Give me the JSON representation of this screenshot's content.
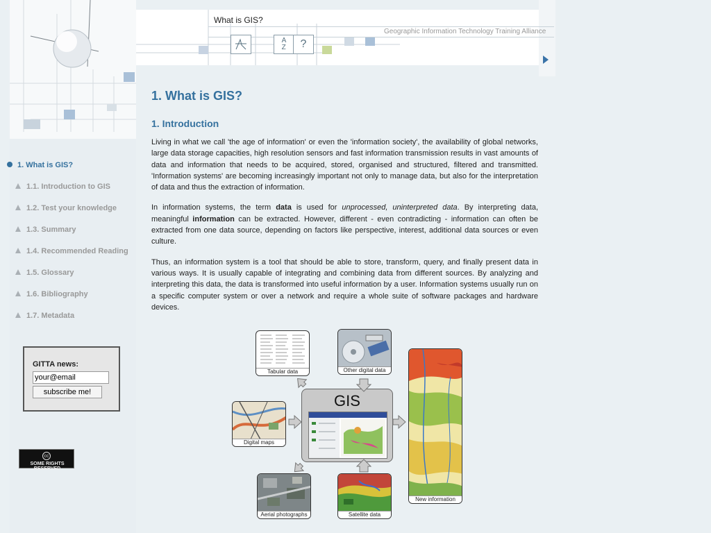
{
  "header": {
    "page_title": "What is GIS?",
    "org_name": "Geographic Information Technology Training Alliance",
    "tool_icons": [
      "glossary-icon",
      "a-z-icon",
      "help-icon"
    ],
    "accent_color": "#35719e"
  },
  "main": {
    "title": "1. What is GIS?",
    "section_title": "1. Introduction",
    "paragraphs": [
      [
        "Living in what we call 'the age of information' or even the 'information society', the availability of global networks, large data storage capacities, high resolution sensors and fast information transmission results in vast amounts of data and information that needs to be acquired, stored, organised and structured, filtered and transmitted. 'Information systems' are becoming increasingly important not only to manage data, but also for the interpretation of data and thus the extraction of information."
      ],
      {
        "p2_a": "In information systems, the term ",
        "p2_b": "data",
        "p2_c": " is used for ",
        "p2_d": "unprocessed, uninterpreted data",
        "p2_e": ". By interpreting data, meaningful ",
        "p2_f": "information",
        "p2_g": " can be extracted. However, different - even contradicting - information can often be extracted from one data source, depending on factors like perspective, interest, additional data sources or even culture."
      },
      [
        "Thus, an information system is a tool that should be able to store, transform, query, and finally present data in various ways. It is usually capable of integrating and combining data from different sources. By analyzing and interpreting this data, the data is transformed into useful information by a user. Information systems usually run on a specific computer system or over a network and require a whole suite of software packages and hardware devices."
      ]
    ]
  },
  "nav": {
    "items": [
      {
        "label": "1. What is GIS?",
        "active": true
      },
      {
        "label": "1.1. Introduction to GIS"
      },
      {
        "label": "1.2. Test your knowledge"
      },
      {
        "label": "1.3. Summary"
      },
      {
        "label": "1.4. Recommended Reading"
      },
      {
        "label": "1.5. Glossary"
      },
      {
        "label": "1.6. Bibliography"
      },
      {
        "label": "1.7. Metadata"
      }
    ]
  },
  "news": {
    "label": "GITTA news:",
    "email_value": "your@email",
    "button": "subscribe me!"
  },
  "license": {
    "text": "SOME RIGHTS RESERVED",
    "symbol": "cc"
  },
  "diagram": {
    "center": "GIS",
    "tabular": "Tabular data",
    "other": "Other digital data",
    "maps": "Digital maps",
    "aerial": "Aerial photographs",
    "satellite": "Satellite data",
    "newinfo": "New information"
  }
}
